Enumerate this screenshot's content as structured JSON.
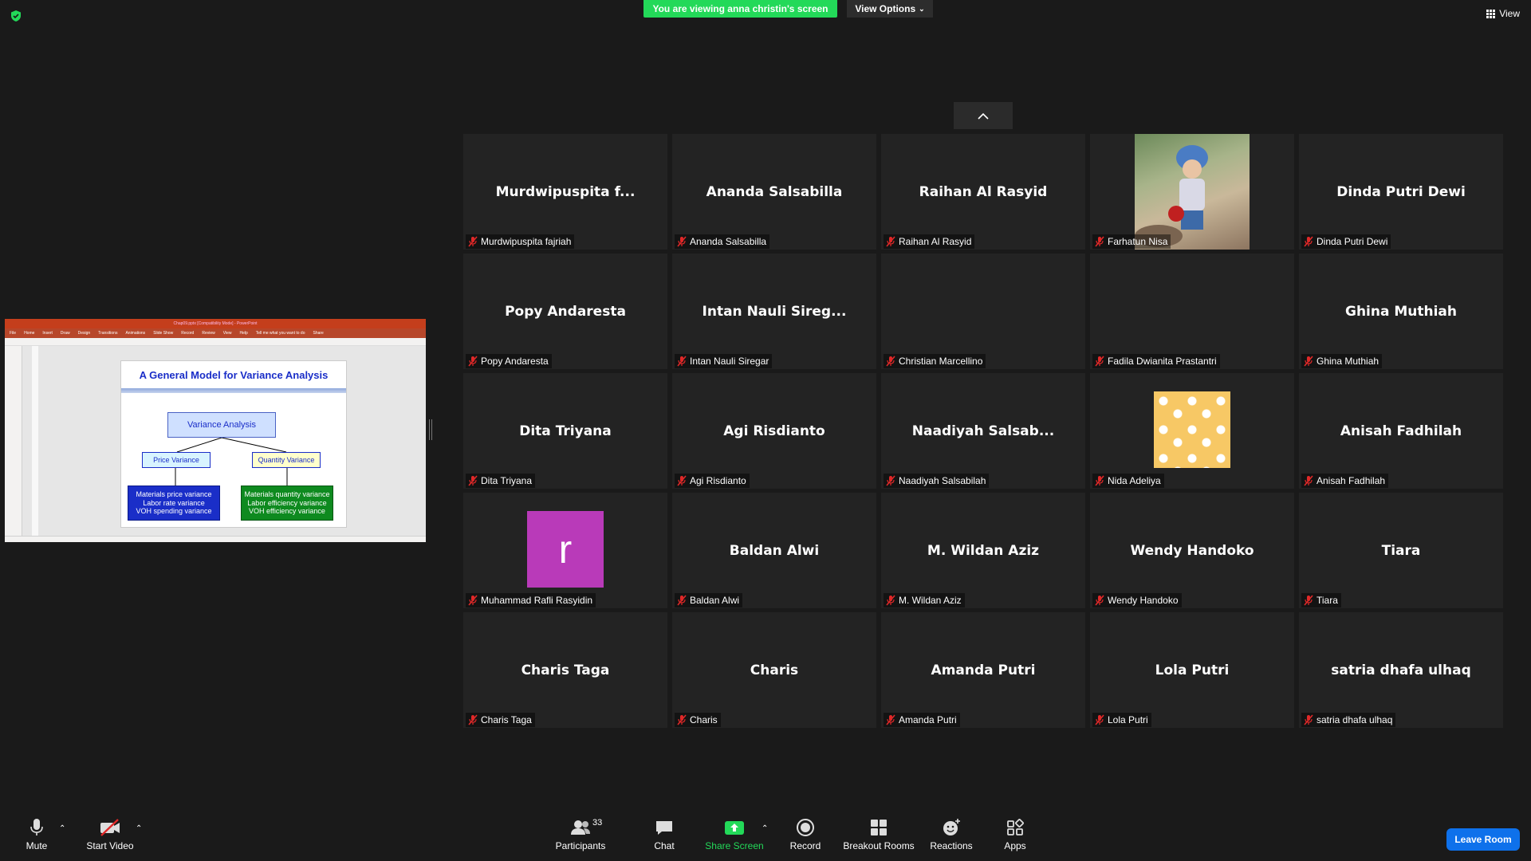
{
  "topbar": {
    "viewing_text": "You are viewing anna christin's screen",
    "view_options_label": "View Options",
    "view_label": "View"
  },
  "shared_screen": {
    "app_title": "Chap09.pptx [Compatibility Mode] - PowerPoint",
    "menu": [
      "File",
      "Home",
      "Insert",
      "Draw",
      "Design",
      "Transitions",
      "Animations",
      "Slide Show",
      "Record",
      "Review",
      "View",
      "Help",
      "Tell me what you want to do",
      "Share"
    ],
    "slide_title": "A General Model for Variance Analysis",
    "box_variance_analysis": "Variance Analysis",
    "box_price_variance": "Price Variance",
    "box_quantity_variance": "Quantity Variance",
    "price_lines": [
      "Materials price variance",
      "Labor rate variance",
      "VOH spending variance"
    ],
    "quantity_lines": [
      "Materials quantity variance",
      "Labor efficiency variance",
      "VOH efficiency variance"
    ]
  },
  "participants": [
    {
      "display": "Murdwipuspita  f...",
      "name": "Murdwipuspita fajriah",
      "avatar": "none"
    },
    {
      "display": "Ananda Salsabilla",
      "name": "Ananda Salsabilla",
      "avatar": "none"
    },
    {
      "display": "Raihan Al Rasyid",
      "name": "Raihan Al Rasyid",
      "avatar": "none"
    },
    {
      "display": "",
      "name": "Farhatun Nisa",
      "avatar": "photo"
    },
    {
      "display": "Dinda Putri Dewi",
      "name": "Dinda Putri Dewi",
      "avatar": "none"
    },
    {
      "display": "Popy Andaresta",
      "name": "Popy Andaresta",
      "avatar": "none"
    },
    {
      "display": "Intan  Nauli Sireg...",
      "name": "Intan Nauli Siregar",
      "avatar": "none"
    },
    {
      "display": "",
      "name": "Christian Marcellino",
      "avatar": "none"
    },
    {
      "display": "",
      "name": "Fadila Dwianita Prastantri",
      "avatar": "none"
    },
    {
      "display": "Ghina Muthiah",
      "name": "Ghina Muthiah",
      "avatar": "none"
    },
    {
      "display": "Dita Triyana",
      "name": "Dita Triyana",
      "avatar": "none"
    },
    {
      "display": "Agi Risdianto",
      "name": "Agi Risdianto",
      "avatar": "none"
    },
    {
      "display": "Naadiyah  Salsab...",
      "name": "Naadiyah Salsabilah",
      "avatar": "none"
    },
    {
      "display": "",
      "name": "Nida Adeliya",
      "avatar": "flowers"
    },
    {
      "display": "Anisah Fadhilah",
      "name": "Anisah Fadhilah",
      "avatar": "none"
    },
    {
      "display": "",
      "name": "Muhammad Rafli Rasyidin",
      "avatar": "letter",
      "letter": "r"
    },
    {
      "display": "Baldan Alwi",
      "name": "Baldan Alwi",
      "avatar": "none"
    },
    {
      "display": "M. Wildan Aziz",
      "name": "M. Wildan Aziz",
      "avatar": "none"
    },
    {
      "display": "Wendy Handoko",
      "name": "Wendy Handoko",
      "avatar": "none"
    },
    {
      "display": "Tiara",
      "name": "Tiara",
      "avatar": "none"
    },
    {
      "display": "Charis Taga",
      "name": "Charis Taga",
      "avatar": "none"
    },
    {
      "display": "Charis",
      "name": "Charis",
      "avatar": "none"
    },
    {
      "display": "Amanda Putri",
      "name": "Amanda Putri",
      "avatar": "none"
    },
    {
      "display": "Lola Putri",
      "name": "Lola Putri",
      "avatar": "none"
    },
    {
      "display": "satria dhafa ulhaq",
      "name": "satria dhafa ulhaq",
      "avatar": "none"
    }
  ],
  "toolbar": {
    "mute": "Mute",
    "start_video": "Start Video",
    "participants": "Participants",
    "participant_count": "33",
    "chat": "Chat",
    "share_screen": "Share Screen",
    "record": "Record",
    "breakout_rooms": "Breakout Rooms",
    "reactions": "Reactions",
    "apps": "Apps",
    "leave_room": "Leave Room"
  },
  "colors": {
    "banner_green": "#23d959",
    "leave_blue": "#0e71eb",
    "muted_red": "#e02828",
    "tile_bg": "#232323"
  }
}
